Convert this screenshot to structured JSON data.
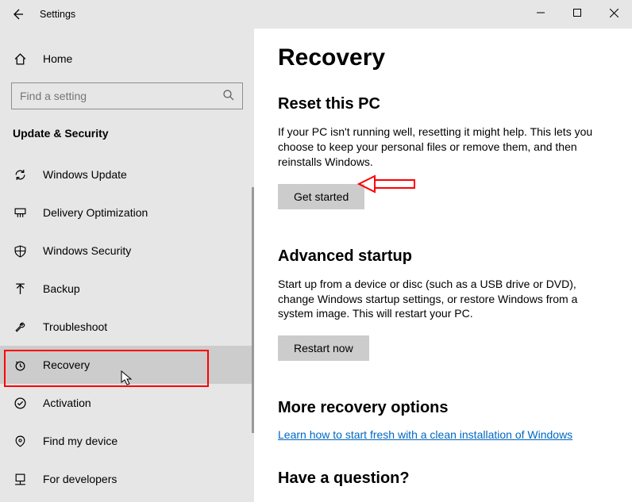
{
  "window": {
    "title": "Settings"
  },
  "sidebar": {
    "home_label": "Home",
    "search_placeholder": "Find a setting",
    "category": "Update & Security",
    "items": [
      {
        "label": "Windows Update",
        "icon": "sync"
      },
      {
        "label": "Delivery Optimization",
        "icon": "delivery"
      },
      {
        "label": "Windows Security",
        "icon": "shield"
      },
      {
        "label": "Backup",
        "icon": "backup"
      },
      {
        "label": "Troubleshoot",
        "icon": "wrench"
      },
      {
        "label": "Recovery",
        "icon": "recovery",
        "selected": true
      },
      {
        "label": "Activation",
        "icon": "check-circle"
      },
      {
        "label": "Find my device",
        "icon": "locate"
      },
      {
        "label": "For developers",
        "icon": "developer"
      }
    ]
  },
  "content": {
    "page_title": "Recovery",
    "sections": {
      "reset": {
        "heading": "Reset this PC",
        "body": "If your PC isn't running well, resetting it might help. This lets you choose to keep your personal files or remove them, and then reinstalls Windows.",
        "button": "Get started"
      },
      "advanced": {
        "heading": "Advanced startup",
        "body": "Start up from a device or disc (such as a USB drive or DVD), change Windows startup settings, or restore Windows from a system image. This will restart your PC.",
        "button": "Restart now"
      },
      "more": {
        "heading": "More recovery options",
        "link": "Learn how to start fresh with a clean installation of Windows"
      },
      "question": {
        "heading": "Have a question?"
      }
    }
  }
}
